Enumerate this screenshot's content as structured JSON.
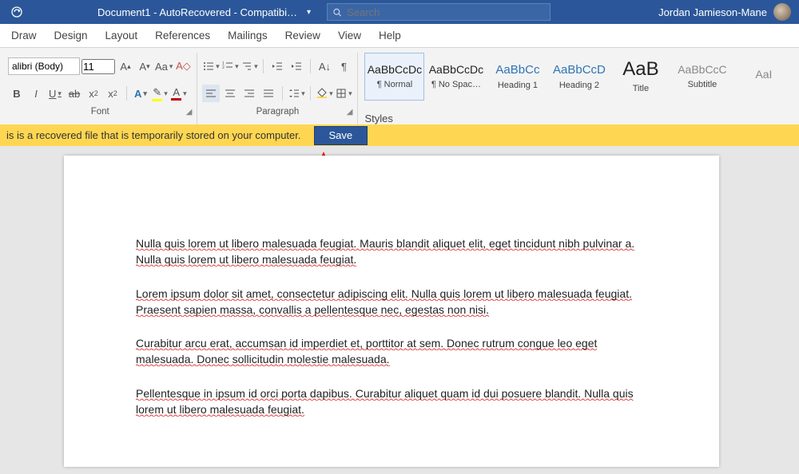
{
  "title": "Document1 - AutoRecovered  -  Compatibi…",
  "search_placeholder": "Search",
  "user_name": "Jordan Jamieson-Mane",
  "tabs": [
    "Draw",
    "Design",
    "Layout",
    "References",
    "Mailings",
    "Review",
    "View",
    "Help"
  ],
  "font": {
    "name": "alibri (Body)",
    "size": "11"
  },
  "groups": {
    "font_label": "Font",
    "para_label": "Paragraph",
    "styles_label": "Styles"
  },
  "styles": [
    {
      "preview": "AaBbCcDc",
      "name": "¶ Normal",
      "cls": "normal"
    },
    {
      "preview": "AaBbCcDc",
      "name": "¶ No Spac…",
      "cls": ""
    },
    {
      "preview": "AaBbCc",
      "name": "Heading 1",
      "cls": "heading"
    },
    {
      "preview": "AaBbCcD",
      "name": "Heading 2",
      "cls": "heading"
    },
    {
      "preview": "AaB",
      "name": "Title",
      "cls": "title"
    },
    {
      "preview": "AaBbCcC",
      "name": "Subtitle",
      "cls": "subtle"
    },
    {
      "preview": "AaI",
      "name": "",
      "cls": "subtle"
    }
  ],
  "message_bar": {
    "text": "is is a recovered file that is temporarily stored on your computer.",
    "button": "Save"
  },
  "doc": {
    "p1a": "Nulla quis lorem ut libero malesuada feugiat. Mauris blandit aliquet elit, eget tincidunt nibh pulvinar a.",
    "p1b": "Nulla quis lorem ut libero malesuada feugiat.",
    "p2a": "Lorem ipsum dolor sit amet, consectetur adipiscing elit. Nulla quis lorem ut libero malesuada feugiat.",
    "p2b": "Praesent sapien massa, convallis a pellentesque nec, egestas non nisi.",
    "p3a": "Curabitur arcu erat, accumsan id imperdiet et, porttitor at sem. Donec rutrum congue leo eget",
    "p3b": "malesuada. Donec sollicitudin molestie malesuada.",
    "p4a": "Pellentesque in ipsum id orci porta dapibus. Curabitur aliquet quam id dui posuere blandit. Nulla quis",
    "p4b": "lorem ut libero malesuada feugiat."
  }
}
